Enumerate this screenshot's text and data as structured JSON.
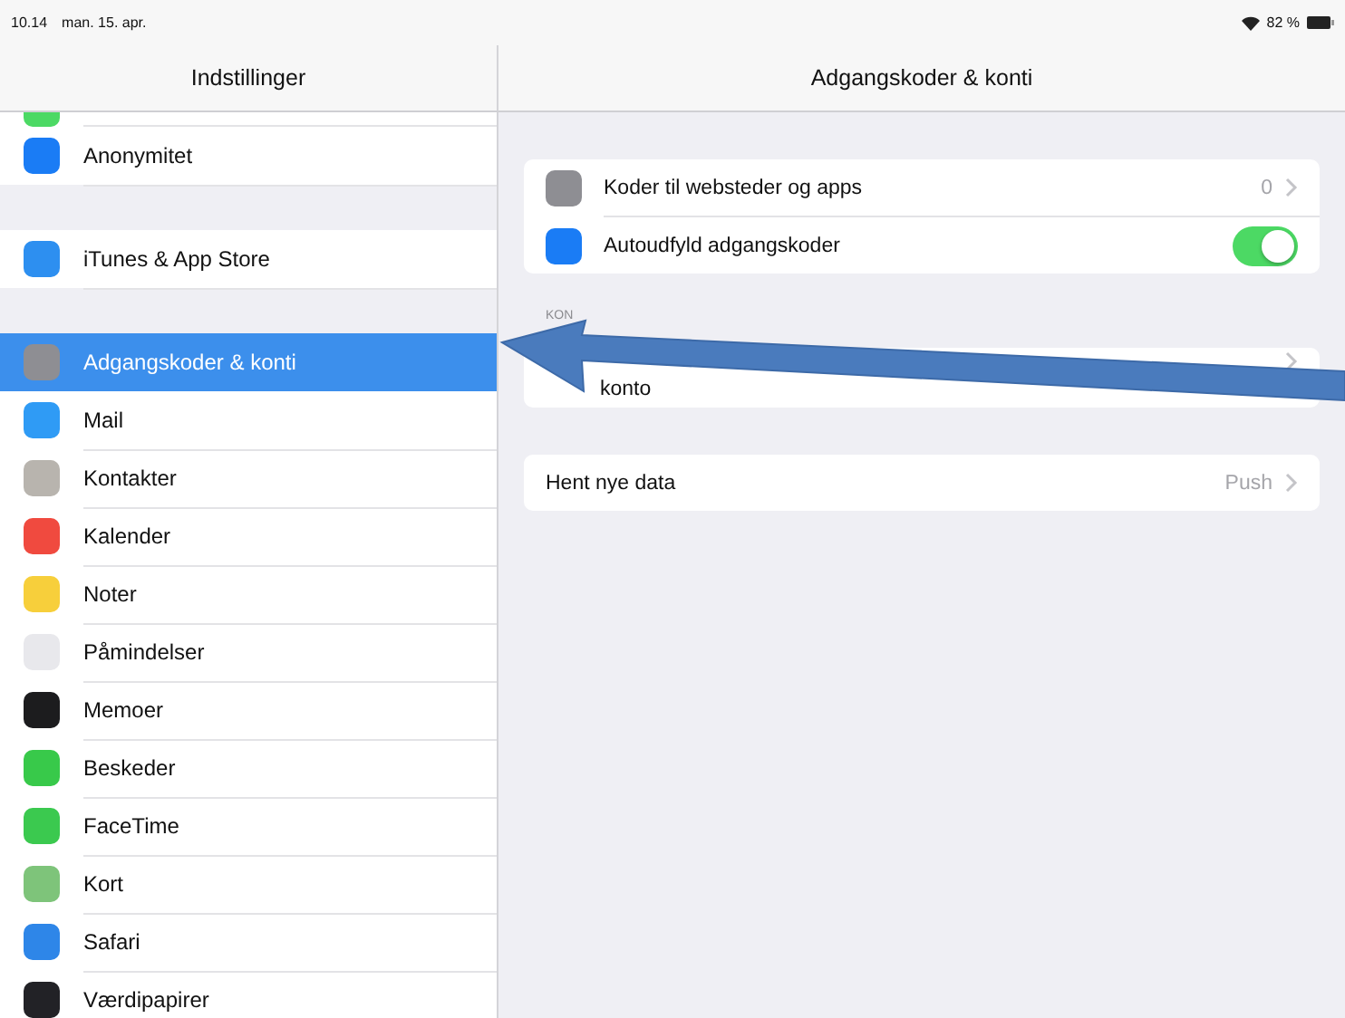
{
  "status_bar": {
    "time": "10.14",
    "date": "man. 15. apr.",
    "battery": "82 %"
  },
  "sidebar": {
    "title": "Indstillinger",
    "groups": [
      {
        "items": [
          {
            "kind": "cut",
            "color": "#4cd964",
            "selected": false
          },
          {
            "label": "Anonymitet",
            "color": "#1a7cf5",
            "selected": false
          }
        ]
      },
      {
        "items": [
          {
            "label": "iTunes & App Store",
            "color": "#2d8ff0",
            "selected": false
          }
        ]
      },
      {
        "items": [
          {
            "label": "Adgangskoder & konti",
            "color": "#8e8e93",
            "selected": true
          },
          {
            "label": "Mail",
            "color": "#2f9bf5",
            "selected": false
          },
          {
            "label": "Kontakter",
            "color": "#b8b4ae",
            "selected": false
          },
          {
            "label": "Kalender",
            "color": "#f04a3f",
            "selected": false
          },
          {
            "label": "Noter",
            "color": "#f7cf3b",
            "selected": false
          },
          {
            "label": "Påmindelser",
            "color": "#e8e8ec",
            "selected": false
          },
          {
            "label": "Memoer",
            "color": "#1c1c1e",
            "selected": false
          },
          {
            "label": "Beskeder",
            "color": "#38c94a",
            "selected": false
          },
          {
            "label": "FaceTime",
            "color": "#3bc94f",
            "selected": false
          },
          {
            "label": "Kort",
            "color": "#7ec47a",
            "selected": false
          },
          {
            "label": "Safari",
            "color": "#2e86e8",
            "selected": false
          },
          {
            "label": "Værdipapirer",
            "color": "#222226",
            "selected": false
          }
        ]
      }
    ]
  },
  "detail": {
    "title": "Adgangskoder & konti",
    "sections": [
      {
        "rows": [
          {
            "kind": "link",
            "label": "Koder til websteder og apps",
            "value": "0",
            "color": "#8e8e93"
          },
          {
            "kind": "toggle",
            "label": "Autoudfyld adgangskoder",
            "on": true,
            "color": "#1a7cf5"
          }
        ]
      },
      {
        "header": "KON",
        "rows": [
          {
            "kind": "link",
            "label": "konto"
          }
        ]
      },
      {
        "rows": [
          {
            "kind": "link",
            "label": "Hent nye data",
            "value": "Push"
          }
        ]
      }
    ]
  }
}
